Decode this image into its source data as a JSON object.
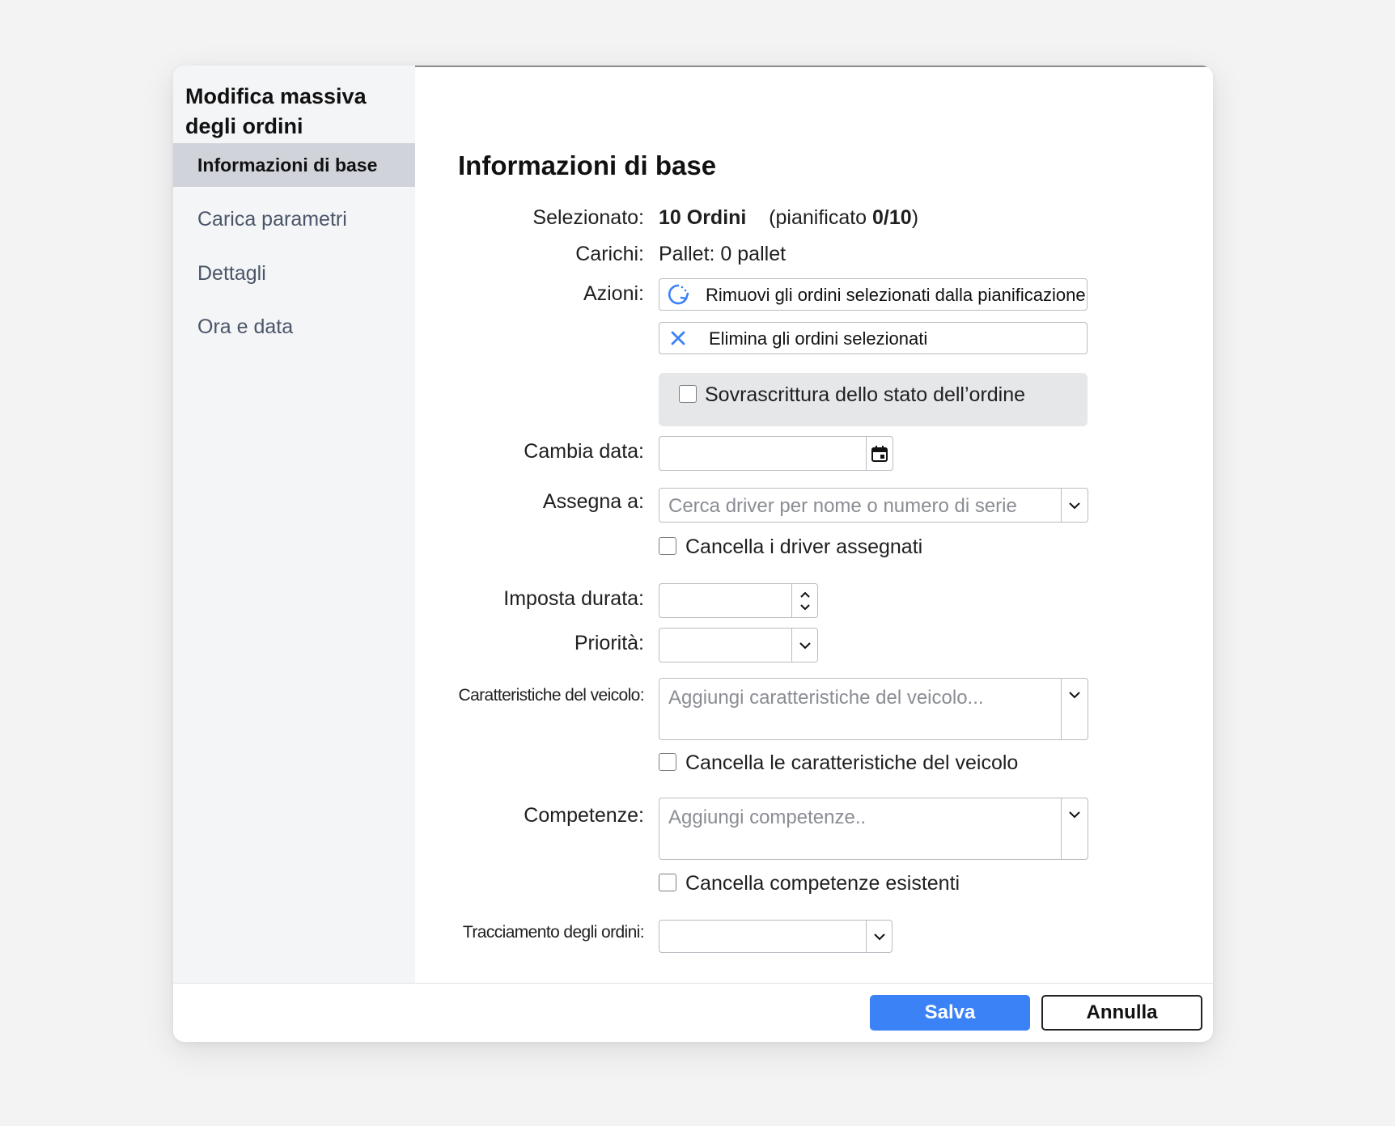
{
  "sidebar": {
    "title": "Modifica massiva degli ordini",
    "items": [
      {
        "label": "Informazioni di base",
        "active": true
      },
      {
        "label": "Carica parametri"
      },
      {
        "label": "Dettagli"
      },
      {
        "label": "Ora e data"
      }
    ]
  },
  "main": {
    "section_title": "Informazioni di base",
    "selected": {
      "label": "Selezionato:",
      "count": "10 Ordini",
      "planned_prefix": "(pianificato ",
      "planned_value": "0/10",
      "planned_suffix": ")"
    },
    "loads": {
      "label": "Carichi:",
      "value": "Pallet: 0 pallet"
    },
    "actions": {
      "label": "Azioni:",
      "remove_label": "Rimuovi gli ordini selezionati dalla pianificazione",
      "delete_label": "Elimina gli ordini selezionati"
    },
    "override_status": {
      "label": "Sovrascrittura dello stato dell’ordine",
      "checked": false
    },
    "change_date": {
      "label": "Cambia data:",
      "value": ""
    },
    "assign": {
      "label": "Assegna a:",
      "placeholder": "Cerca driver per nome o numero di serie"
    },
    "clear_drivers": {
      "label": "Cancella i driver assegnati",
      "checked": false
    },
    "duration": {
      "label": "Imposta durata:",
      "value": ""
    },
    "priority": {
      "label": "Priorità:",
      "value": ""
    },
    "vehicle_features": {
      "label": "Caratteristiche del veicolo:",
      "placeholder": "Aggiungi caratteristiche del veicolo..."
    },
    "clear_vehicle_features": {
      "label": "Cancella le caratteristiche del veicolo",
      "checked": false
    },
    "skills": {
      "label": "Competenze:",
      "placeholder": "Aggiungi competenze.."
    },
    "clear_skills": {
      "label": "Cancella competenze esistenti",
      "checked": false
    },
    "tracking": {
      "label": "Tracciamento degli ordini:",
      "value": ""
    }
  },
  "footer": {
    "save_label": "Salva",
    "cancel_label": "Annulla"
  },
  "colors": {
    "accent": "#3b82f6",
    "sidebar_bg": "#f4f5f7",
    "active_item_bg": "#d0d4da"
  }
}
